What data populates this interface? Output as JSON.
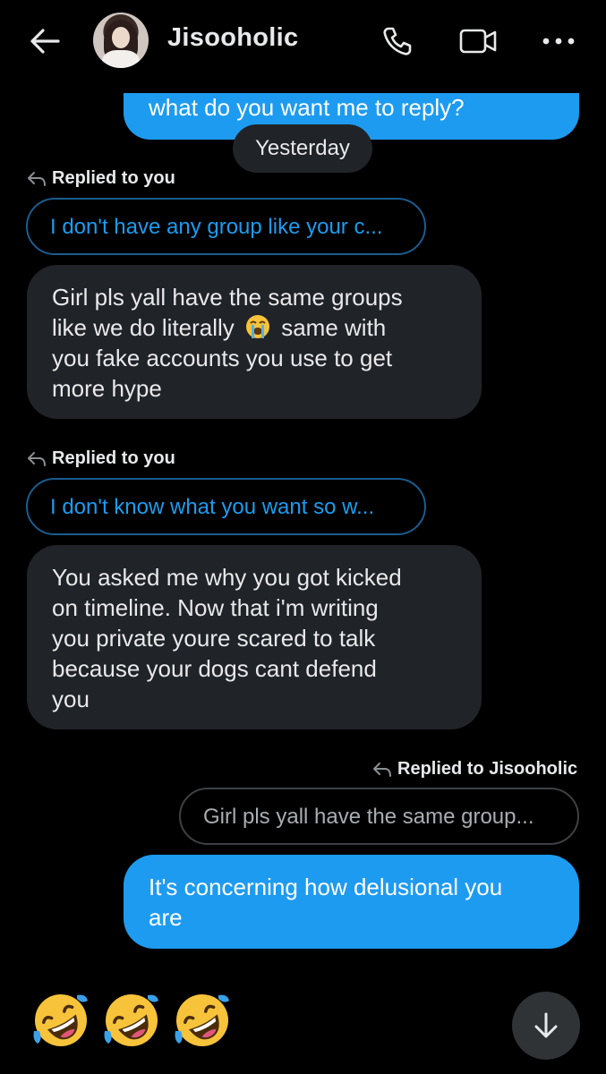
{
  "header": {
    "contact_name": "Jisooholic"
  },
  "messages": {
    "top_sent": "what do you want me to reply?",
    "date_divider": "Yesterday",
    "reply1_label": "Replied to you",
    "reply1_quote": "I don't have any group like your c...",
    "msg1_line1": "Girl pls yall have the same groups",
    "msg1_line2a": "like we do literally",
    "msg1_line2b": "same with",
    "msg1_line3": "you fake accounts you use to get",
    "msg1_line4": "more hype",
    "reply2_label": "Replied to you",
    "reply2_quote": "I don't know what you want so w...",
    "msg2_line1": "You asked me why you got kicked",
    "msg2_line2": "on timeline. Now that i'm writing",
    "msg2_line3": "you private youre scared to talk",
    "msg2_line4": "because your dogs cant defend",
    "msg2_line5": "you",
    "reply3_label": "Replied to Jisooholic",
    "reply3_quote": "Girl pls yall have the same group...",
    "sent_line1": "It's concerning how delusional you",
    "sent_line2": "are"
  },
  "icons": {
    "back": "arrow-left-icon",
    "phone": "phone-icon",
    "video": "video-camera-icon",
    "more": "more-horizontal-icon",
    "reply": "reply-arrow-icon",
    "crying_emoji": "loudly-crying-face",
    "laugh_emoji": "rolling-on-floor-laughing",
    "scroll": "arrow-down-icon"
  },
  "colors": {
    "background": "#000000",
    "sent_bubble": "#1d9bf0",
    "received_bubble": "#202327",
    "quote_blue_text": "#1d9bf0",
    "text_primary": "#e7e9ea"
  }
}
